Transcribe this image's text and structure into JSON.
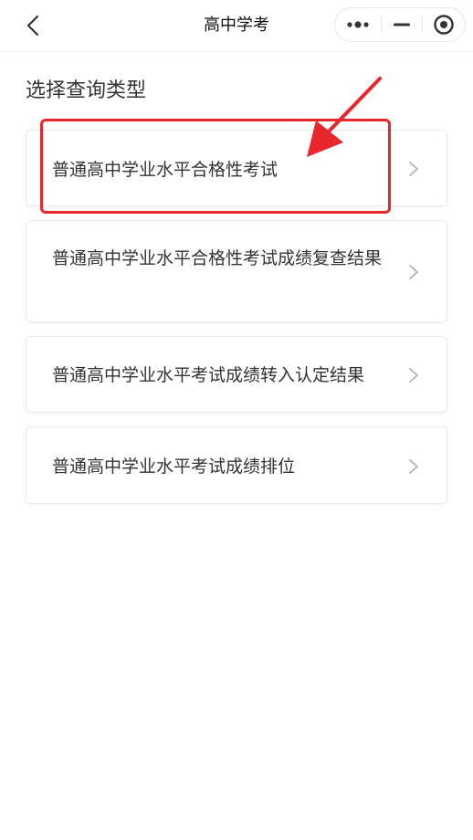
{
  "navbar": {
    "title": "高中学考",
    "back_icon": "chevron-left-icon",
    "capsule": {
      "more_icon": "more-dots-icon",
      "minimize_icon": "minimize-icon",
      "close_icon": "target-circle-icon"
    }
  },
  "main": {
    "section_title": "选择查询类型",
    "options": [
      {
        "label": "普通高中学业水平合格性考试",
        "icon": "chevron-right-icon"
      },
      {
        "label": "普通高中学业水平合格性考试成绩复查结果",
        "icon": "chevron-right-icon"
      },
      {
        "label": "普通高中学业水平考试成绩转入认定结果",
        "icon": "chevron-right-icon"
      },
      {
        "label": "普通高中学业水平考试成绩排位",
        "icon": "chevron-right-icon"
      }
    ]
  },
  "annotation": {
    "highlight_color": "#e8262c",
    "arrow_icon": "red-arrow-icon"
  },
  "colors": {
    "text": "#333333",
    "title": "#111111",
    "chevron": "#b2b2b2",
    "border": "#ebebeb",
    "accent_red": "#e8262c"
  }
}
